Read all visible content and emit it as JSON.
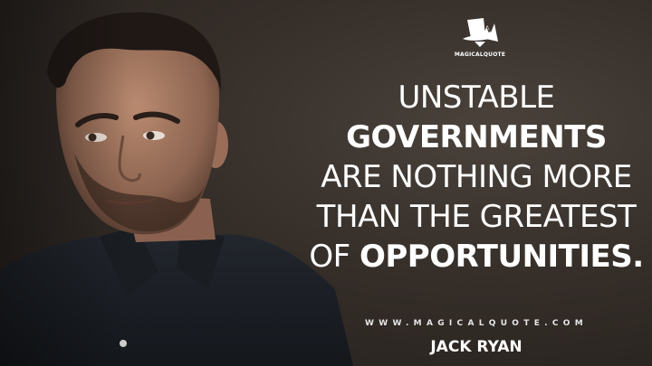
{
  "brand": {
    "logo_text": "MAGICALQUOTE",
    "website": "WWW.MAGICALQUOTE.COM"
  },
  "quote": {
    "lines": [
      [
        {
          "text": "UNSTABLE",
          "bold": false
        }
      ],
      [
        {
          "text": "GOVERNMENTS",
          "bold": true
        }
      ],
      [
        {
          "text": "ARE NOTHING MORE",
          "bold": false
        }
      ],
      [
        {
          "text": "THAN THE GREATEST",
          "bold": false
        }
      ],
      [
        {
          "text": "OF ",
          "bold": false
        },
        {
          "text": "OPPORTUNITIES.",
          "bold": true
        }
      ]
    ]
  },
  "speaker": "JACK RYAN",
  "colors": {
    "background": "#352e29",
    "text": "#ffffff"
  }
}
